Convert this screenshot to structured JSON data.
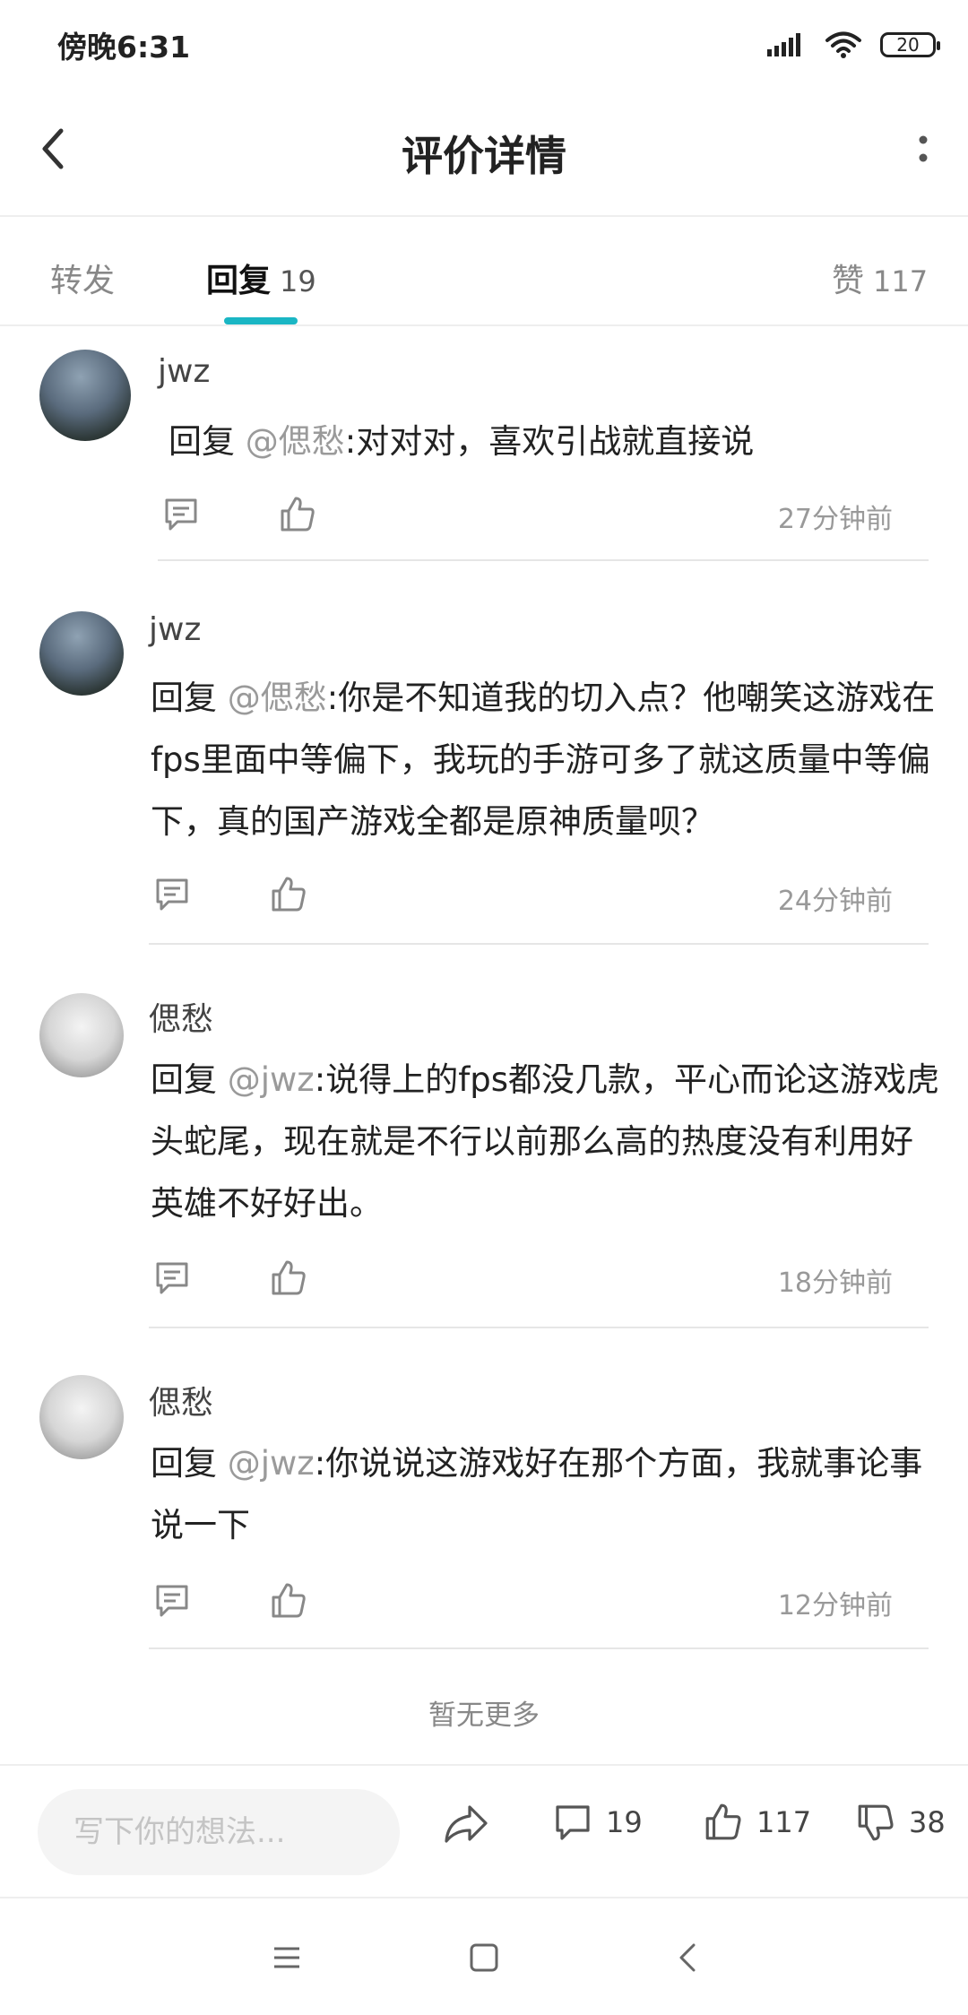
{
  "status_bar": {
    "time": "傍晚6:31",
    "battery": "20",
    "icons": [
      "signal-icon",
      "wifi-icon",
      "battery-icon"
    ]
  },
  "header": {
    "title": "评价详情",
    "icons": [
      "back-arrow-icon",
      "more-vertical-icon"
    ]
  },
  "tabs": {
    "forward": {
      "label": "转发"
    },
    "reply": {
      "label": "回复",
      "count": "19",
      "active": true
    },
    "like": {
      "label": "赞",
      "count": "117"
    }
  },
  "comments": [
    {
      "username": "jwz",
      "reply_prefix": "回复 ",
      "mention": "@偲愁",
      "text": ":对对对，喜欢引战就直接说",
      "time": "27分钟前"
    },
    {
      "username": "jwz",
      "reply_prefix": "回复 ",
      "mention": "@偲愁",
      "text": ":你是不知道我的切入点？他嘲笑这游戏在fps里面中等偏下，我玩的手游可多了就这质量中等偏下，真的国产游戏全都是原神质量呗？",
      "time": "24分钟前"
    },
    {
      "username": "偲愁",
      "reply_prefix": "回复 ",
      "mention": "@jwz",
      "text": ":说得上的fps都没几款，平心而论这游戏虎头蛇尾，现在就是不行以前那么高的热度没有利用好英雄不好好出。",
      "time": "18分钟前"
    },
    {
      "username": "偲愁",
      "reply_prefix": "回复 ",
      "mention": "@jwz",
      "text": ":你说说这游戏好在那个方面，我就事论事说一下",
      "time": "12分钟前"
    }
  ],
  "footer_note": "暂无更多",
  "bottom_bar": {
    "input_placeholder": "写下你的想法...",
    "comment_count": "19",
    "like_count": "117",
    "dislike_count": "38",
    "icons": [
      "share-icon",
      "comment-icon",
      "thumbs-up-icon",
      "thumbs-down-icon"
    ]
  },
  "nav_bar": {
    "icons": [
      "menu-icon",
      "home-icon",
      "back-icon"
    ]
  },
  "colors": {
    "accent": "#1ab6c4",
    "mention": "#9a9a9a",
    "muted": "#999999"
  }
}
